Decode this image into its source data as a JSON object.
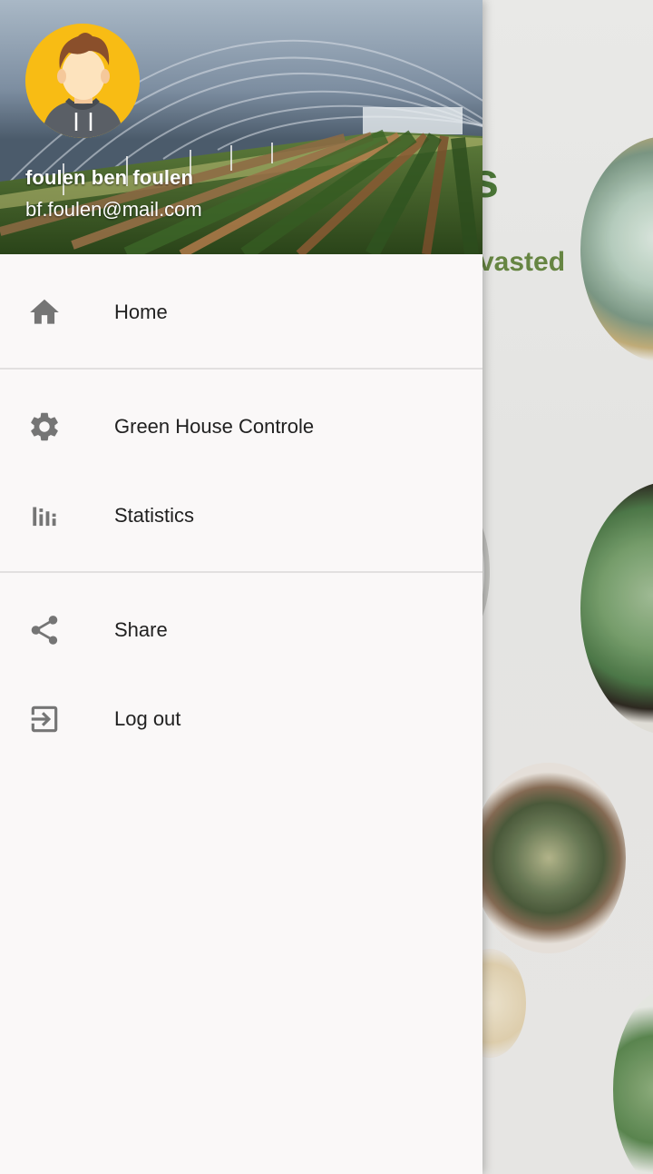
{
  "header": {
    "user_name": "foulen ben foulen",
    "user_email": "bf.foulen@mail.com"
  },
  "menu": {
    "items": [
      {
        "label": "Home",
        "icon": "home-icon"
      },
      {
        "label": "Green House Controle",
        "icon": "gear-icon"
      },
      {
        "label": "Statistics",
        "icon": "bar-chart-icon"
      },
      {
        "label": "Share",
        "icon": "share-icon"
      },
      {
        "label": "Log out",
        "icon": "logout-icon"
      }
    ]
  },
  "background": {
    "title_fragment": "s",
    "subtitle_fragment": "vasted"
  },
  "colors": {
    "drawer_bg": "#faf8f8",
    "icon": "#757575",
    "text": "#212121",
    "avatar_bg": "#f8bc14",
    "brand_green": "#4e7a39"
  }
}
